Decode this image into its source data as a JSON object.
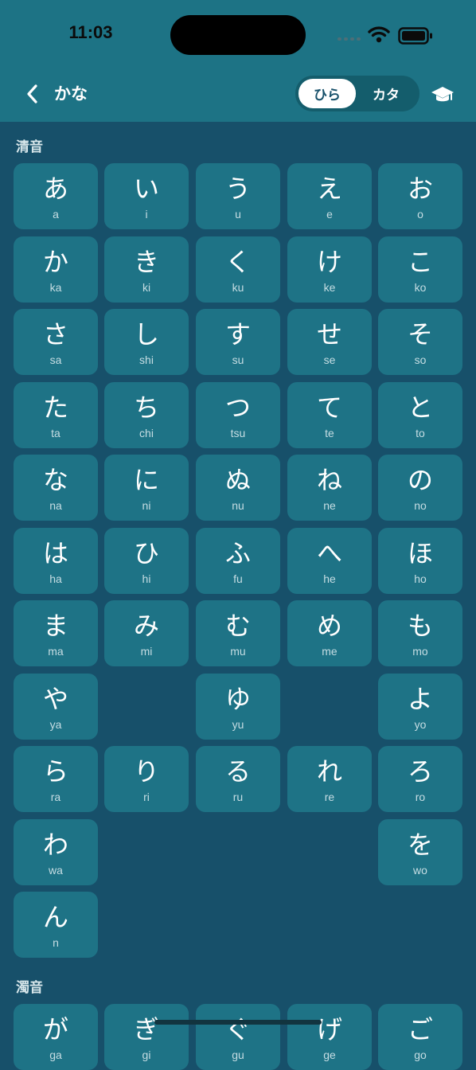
{
  "status_bar": {
    "time": "11:03"
  },
  "nav": {
    "title": "かな",
    "segments": [
      "ひら",
      "カタ"
    ],
    "selected_segment": "ひら",
    "icons": {
      "back": "chevron-left-icon",
      "learn": "graduation-cap-icon"
    }
  },
  "sections": [
    {
      "title": "清音",
      "rows": [
        [
          {
            "kana": "あ",
            "romaji": "a"
          },
          {
            "kana": "い",
            "romaji": "i"
          },
          {
            "kana": "う",
            "romaji": "u"
          },
          {
            "kana": "え",
            "romaji": "e"
          },
          {
            "kana": "お",
            "romaji": "o"
          }
        ],
        [
          {
            "kana": "か",
            "romaji": "ka"
          },
          {
            "kana": "き",
            "romaji": "ki"
          },
          {
            "kana": "く",
            "romaji": "ku"
          },
          {
            "kana": "け",
            "romaji": "ke"
          },
          {
            "kana": "こ",
            "romaji": "ko"
          }
        ],
        [
          {
            "kana": "さ",
            "romaji": "sa"
          },
          {
            "kana": "し",
            "romaji": "shi"
          },
          {
            "kana": "す",
            "romaji": "su"
          },
          {
            "kana": "せ",
            "romaji": "se"
          },
          {
            "kana": "そ",
            "romaji": "so"
          }
        ],
        [
          {
            "kana": "た",
            "romaji": "ta"
          },
          {
            "kana": "ち",
            "romaji": "chi"
          },
          {
            "kana": "つ",
            "romaji": "tsu"
          },
          {
            "kana": "て",
            "romaji": "te"
          },
          {
            "kana": "と",
            "romaji": "to"
          }
        ],
        [
          {
            "kana": "な",
            "romaji": "na"
          },
          {
            "kana": "に",
            "romaji": "ni"
          },
          {
            "kana": "ぬ",
            "romaji": "nu"
          },
          {
            "kana": "ね",
            "romaji": "ne"
          },
          {
            "kana": "の",
            "romaji": "no"
          }
        ],
        [
          {
            "kana": "は",
            "romaji": "ha"
          },
          {
            "kana": "ひ",
            "romaji": "hi"
          },
          {
            "kana": "ふ",
            "romaji": "fu"
          },
          {
            "kana": "へ",
            "romaji": "he"
          },
          {
            "kana": "ほ",
            "romaji": "ho"
          }
        ],
        [
          {
            "kana": "ま",
            "romaji": "ma"
          },
          {
            "kana": "み",
            "romaji": "mi"
          },
          {
            "kana": "む",
            "romaji": "mu"
          },
          {
            "kana": "め",
            "romaji": "me"
          },
          {
            "kana": "も",
            "romaji": "mo"
          }
        ],
        [
          {
            "kana": "や",
            "romaji": "ya"
          },
          null,
          {
            "kana": "ゆ",
            "romaji": "yu"
          },
          null,
          {
            "kana": "よ",
            "romaji": "yo"
          }
        ],
        [
          {
            "kana": "ら",
            "romaji": "ra"
          },
          {
            "kana": "り",
            "romaji": "ri"
          },
          {
            "kana": "る",
            "romaji": "ru"
          },
          {
            "kana": "れ",
            "romaji": "re"
          },
          {
            "kana": "ろ",
            "romaji": "ro"
          }
        ],
        [
          {
            "kana": "わ",
            "romaji": "wa"
          },
          null,
          null,
          null,
          {
            "kana": "を",
            "romaji": "wo"
          }
        ],
        [
          {
            "kana": "ん",
            "romaji": "n"
          },
          null,
          null,
          null,
          null
        ]
      ]
    },
    {
      "title": "濁音",
      "rows": [
        [
          {
            "kana": "が",
            "romaji": "ga"
          },
          {
            "kana": "ぎ",
            "romaji": "gi"
          },
          {
            "kana": "ぐ",
            "romaji": "gu"
          },
          {
            "kana": "げ",
            "romaji": "ge"
          },
          {
            "kana": "ご",
            "romaji": "go"
          }
        ]
      ]
    }
  ],
  "colors": {
    "header": "#1d7385",
    "background": "#17506a",
    "tile": "#1e7386",
    "text": "#ffffff",
    "romaji": "#c6dde3"
  }
}
